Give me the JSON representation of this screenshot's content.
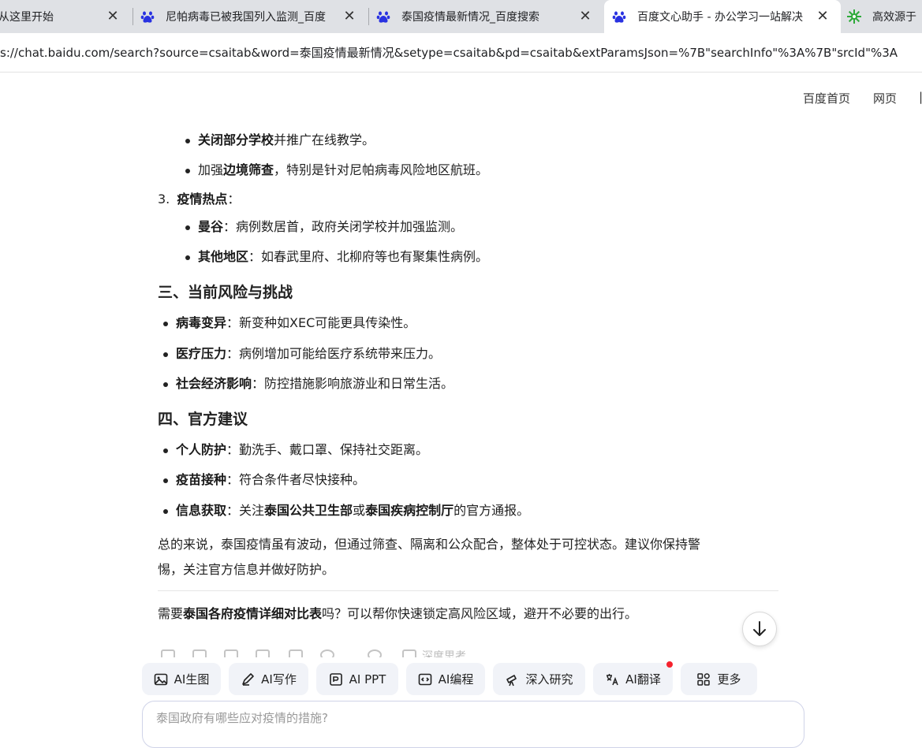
{
  "browser": {
    "tabs": [
      {
        "title": "从这里开始",
        "active": false
      },
      {
        "title": "尼帕病毒已被我国列入监测_百度",
        "active": false
      },
      {
        "title": "泰国疫情最新情况_百度搜索",
        "active": false
      },
      {
        "title": "百度文心助手 - 办公学习一站解决",
        "active": true
      },
      {
        "title": "高效源于",
        "active": false
      }
    ],
    "url": "s://chat.baidu.com/search?source=csaitab&word=泰国疫情最新情况&setype=csaitab&pd=csaitab&extParamsJson=%7B\"searchInfo\"%3A%7B\"srcId\"%3A"
  },
  "toplinks": {
    "home": "百度首页",
    "web": "网页",
    "more": "|"
  },
  "article": {
    "b1": {
      "bold": "关闭部分学校",
      "rest": "并推广在线教学。"
    },
    "b2": {
      "pre": "加强",
      "bold": "边境筛查",
      "rest": "，特别是针对尼帕病毒风险地区航班。"
    },
    "item3": {
      "num": "3.",
      "bold": "疫情热点",
      "rest": "："
    },
    "b3": {
      "bold": "曼谷",
      "rest": "：病例数居首，政府关闭学校并加强监测。"
    },
    "b4": {
      "bold": "其他地区",
      "rest": "：如春武里府、北柳府等也有聚集性病例。"
    },
    "h_risk": "三、当前风险与挑战",
    "r1": {
      "bold": "病毒变异",
      "rest": "：新变种如XEC可能更具传染性。"
    },
    "r2": {
      "bold": "医疗压力",
      "rest": "：病例增加可能给医疗系统带来压力。"
    },
    "r3": {
      "bold": "社会经济影响",
      "rest": "：防控措施影响旅游业和日常生活。"
    },
    "h_advice": "四、官方建议",
    "a1": {
      "bold": "个人防护",
      "rest": "：勤洗手、戴口罩、保持社交距离。"
    },
    "a2": {
      "bold": "疫苗接种",
      "rest": "：符合条件者尽快接种。"
    },
    "a3": {
      "bold": "信息获取",
      "mid1": "：关注",
      "bold2": "泰国公共卫生部",
      "mid2": "或",
      "bold3": "泰国疾病控制厅",
      "rest": "的官方通报。"
    },
    "summary_line1": "总的来说，泰国疫情虽有波动，但通过筛查、隔离和公众配合，整体处于可控状态。建议你保持警",
    "summary_line2": "惕，关注官方信息并做好防护。",
    "followup": {
      "pre": "需要",
      "bold": "泰国各府疫情详细对比表",
      "rest": "吗？可以帮你快速锁定高风险区域，避开不必要的出行。"
    },
    "deep_think": "深度思考"
  },
  "tools": [
    {
      "label": "AI生图",
      "icon": "image-icon"
    },
    {
      "label": "AI写作",
      "icon": "pen-icon"
    },
    {
      "label": "AI PPT",
      "icon": "ppt-icon"
    },
    {
      "label": "AI编程",
      "icon": "code-icon"
    },
    {
      "label": "深入研究",
      "icon": "telescope-icon"
    },
    {
      "label": "AI翻译",
      "icon": "translate-icon"
    },
    {
      "label": "更多",
      "icon": "grid-icon"
    }
  ],
  "input": {
    "placeholder": "泰国政府有哪些应对疫情的措施?"
  },
  "colors": {
    "tabbar": "#dfe1e5",
    "chip_bg": "#f1f3f8",
    "notify_dot": "#f5222d",
    "baidu_blue": "#2932e1"
  }
}
